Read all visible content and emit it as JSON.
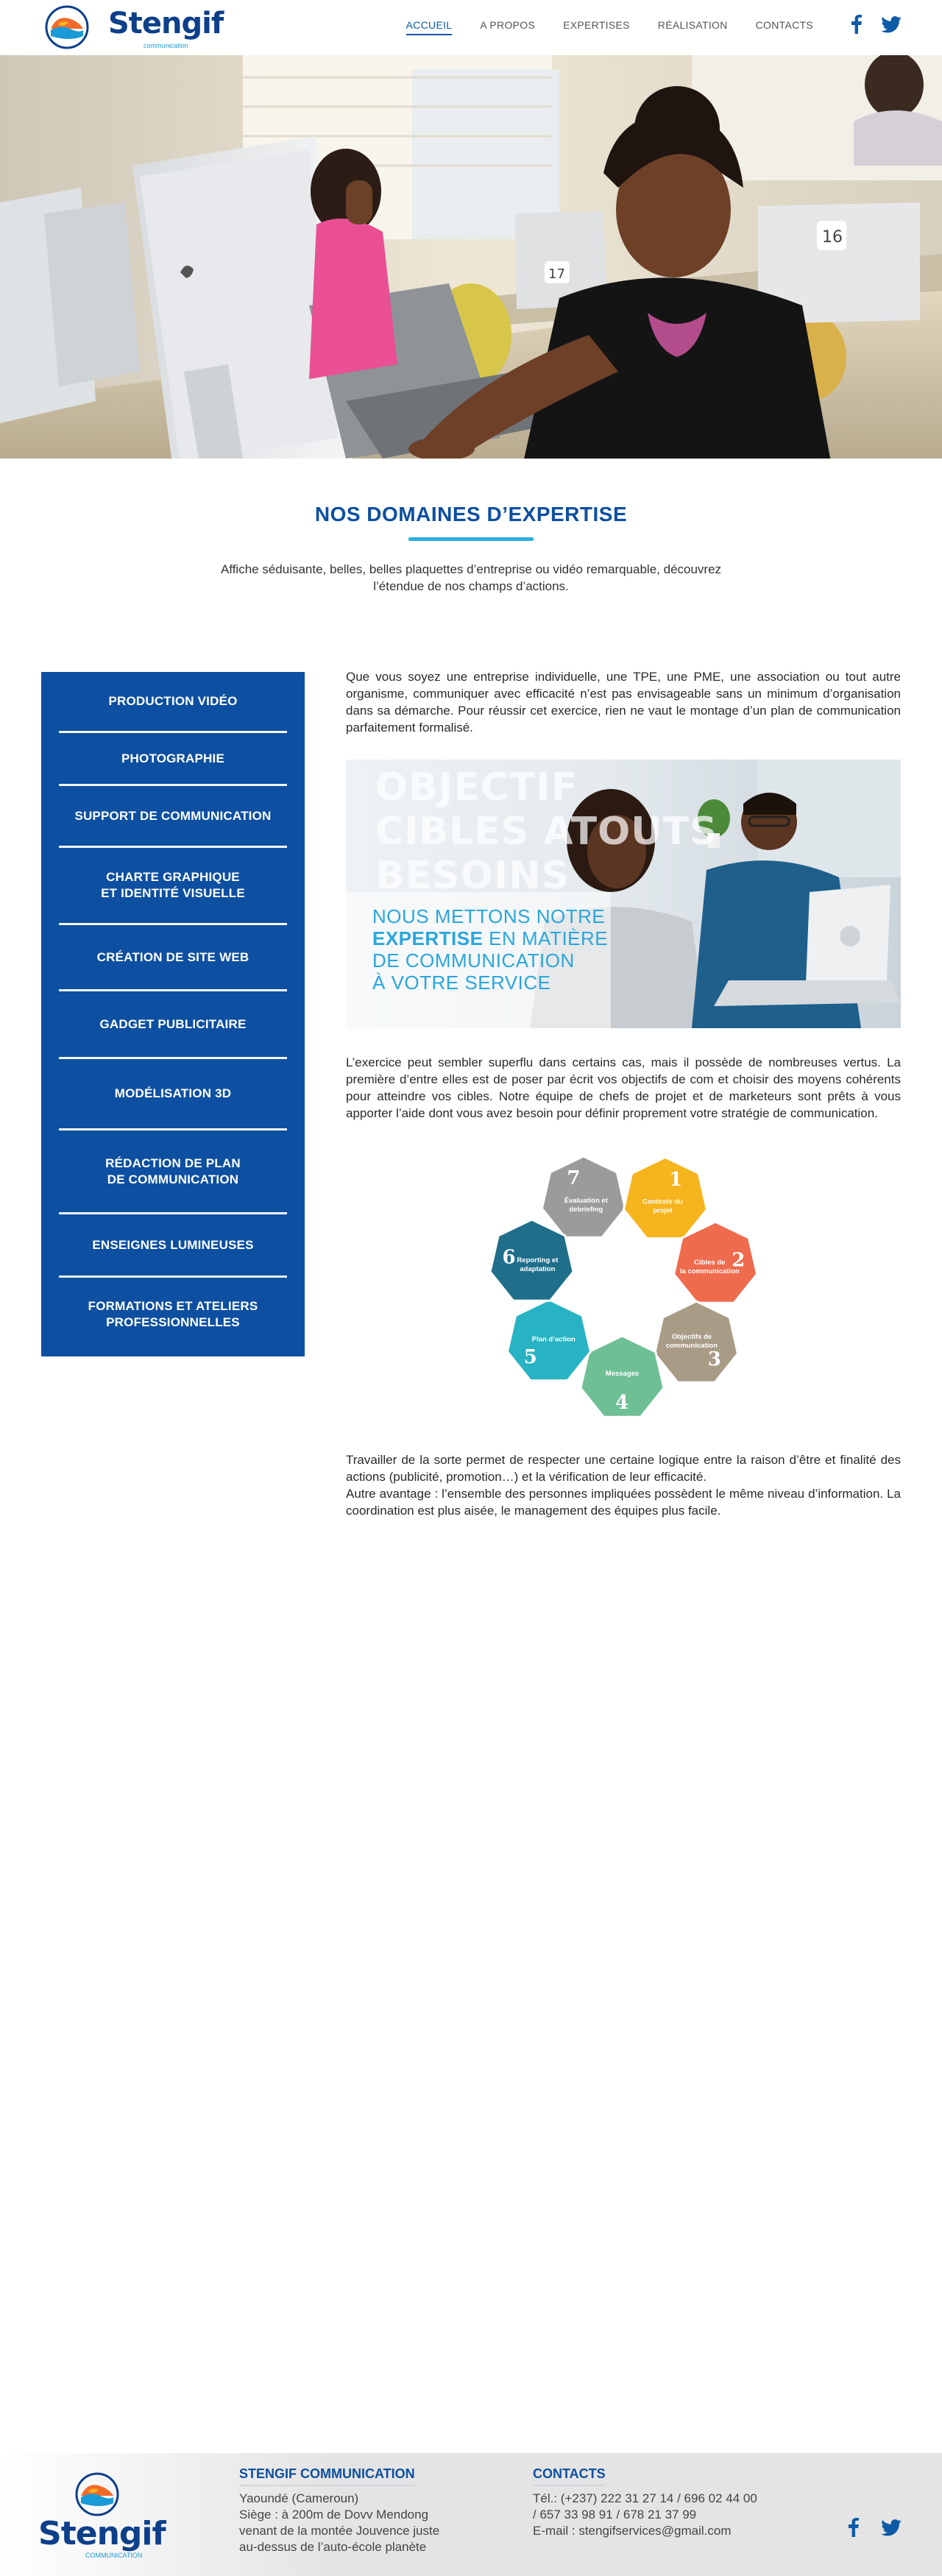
{
  "brand": {
    "name": "Stengif",
    "tagline": "communication"
  },
  "nav": {
    "items": [
      {
        "label": "ACCUEIL",
        "active": true
      },
      {
        "label": "A PROPOS",
        "active": false
      },
      {
        "label": "EXPERTISES",
        "active": false
      },
      {
        "label": "RÉALISATION",
        "active": false
      },
      {
        "label": "CONTACTS",
        "active": false
      }
    ],
    "social": [
      "facebook-icon",
      "twitter-icon"
    ]
  },
  "section": {
    "title": "NOS DOMAINES D’EXPERTISE",
    "intro": "Affiche séduisante, belles, belles plaquettes d’entreprise ou vidéo remarquable, découvrez l’étendue de nos champs d’actions."
  },
  "sidebar": {
    "items": [
      {
        "label": "PRODUCTION VIDÉO"
      },
      {
        "label": "PHOTOGRAPHIE"
      },
      {
        "label": "SUPPORT DE COMMUNICATION"
      },
      {
        "label": "CHARTE GRAPHIQUE\nET IDENTITÉ VISUELLE"
      },
      {
        "label": "CRÉATION DE SITE WEB"
      },
      {
        "label": "GADGET PUBLICITAIRE"
      },
      {
        "label": "MODÉLISATION 3D"
      },
      {
        "label": "RÉDACTION DE PLAN\nDE COMMUNICATION"
      },
      {
        "label": "ENSEIGNES LUMINEUSES"
      },
      {
        "label": "FORMATIONS ET ATELIERS\nPROFESSIONNELLES"
      }
    ]
  },
  "content": {
    "para1": "Que vous soyez  une entreprise individuelle, une TPE, une PME, une association ou tout autre organisme, communiquer avec efficacité n’est pas envisageable sans un minimum d’organisation dans sa démarche. Pour réussir cet exercice, rien ne vaut le montage d’un plan de communication parfaitement formalisé.",
    "para2": "L’exercice peut sembler superflu dans certains cas, mais il possède de nombreuses vertus. La première d’entre elles est de poser par écrit vos objectifs de com et choisir des moyens cohérents pour atteindre vos cibles. Notre équipe de chefs de projet et de marketeurs sont prêts à vous apporter l’aide dont vous avez besoin pour définir proprement votre stratégie de communication.",
    "para3a": "Travailler de la sorte permet de respecter une certaine logique entre la raison d’être et finalité des actions (publicité, promotion…) et la vérification de leur efficacité.",
    "para3b": "Autre avantage : l’ensemble des personnes impliquées possèdent le même niveau d’information. La coordination est plus aisée, le management des équipes plus facile."
  },
  "banner": {
    "big_line1": "OBJECTIF",
    "big_line2": "CIBLES ATOUTS",
    "big_line3": "BESOINS",
    "line1": "NOUS METTONS NOTRE",
    "line2_bold": "EXPERTISE",
    "line2_rest": " EN MATIÈRE",
    "line3": "DE COMMUNICATION",
    "line4": "À VOTRE SERVICE"
  },
  "cycle": {
    "steps": [
      {
        "num": "1",
        "label": "Contexte du projet",
        "color": "#f6b41d"
      },
      {
        "num": "2",
        "label": "Cibles de la communication",
        "color": "#ee6b4d"
      },
      {
        "num": "3",
        "label": "Objectifs de communication",
        "color": "#a89c87"
      },
      {
        "num": "4",
        "label": "Messages",
        "color": "#6fbf95"
      },
      {
        "num": "5",
        "label": "Plan d’action",
        "color": "#27b3c3"
      },
      {
        "num": "6",
        "label": "Reporting et adaptation",
        "color": "#1f6f8b"
      },
      {
        "num": "7",
        "label": "Évaluation et debriefing",
        "color": "#9b9b9b"
      }
    ]
  },
  "footer": {
    "company_title": "STENGIF COMMUNICATION",
    "company_lines": [
      "Yaoundé (Cameroun)",
      "Siège : à 200m de Dovv Mendong",
      "venant de la montée Jouvence juste",
      "au-dessus de l’auto-école planète"
    ],
    "contacts_title": "CONTACTS",
    "contact_lines": [
      "Tél.: (+237) 222 31 27 14 / 696 02 44 00",
      "/ 657 33 98 91 / 678 21 37 99",
      "E-mail : stengifservices@gmail.com"
    ],
    "brand_name": "Stengif",
    "brand_sub": "COMMUNICATION"
  },
  "colors": {
    "primary": "#0d4fa0",
    "accent": "#2eaee0"
  }
}
